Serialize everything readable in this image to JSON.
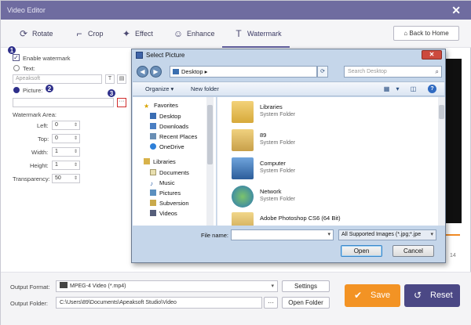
{
  "app": {
    "title": "Video Editor",
    "close_glyph": "✕"
  },
  "toolbar": {
    "tabs": [
      {
        "label": "Rotate",
        "icon": "rotate-icon",
        "glyph": "⟳"
      },
      {
        "label": "Crop",
        "icon": "crop-icon",
        "glyph": "⌐"
      },
      {
        "label": "Effect",
        "icon": "effect-icon",
        "glyph": "✦"
      },
      {
        "label": "Enhance",
        "icon": "enhance-icon",
        "glyph": "☺"
      },
      {
        "label": "Watermark",
        "icon": "watermark-icon",
        "glyph": "T"
      }
    ],
    "active_tab": "Watermark",
    "back_home": "Back to Home"
  },
  "steps": {
    "one": "1",
    "two": "2",
    "three": "3"
  },
  "watermark": {
    "enable_label": "Enable watermark",
    "enable_checked": true,
    "text_label": "Text:",
    "text_value": "Apeaksoft",
    "picture_label": "Picture:",
    "picture_value": "",
    "mode": "Picture",
    "browse_label": "···",
    "area_label": "Watermark Area:",
    "left_label": "Left:",
    "left_value": "0",
    "top_label": "Top:",
    "top_value": "0",
    "width_label": "Width:",
    "width_value": "1",
    "height_label": "Height:",
    "height_value": "1",
    "transparency_label": "Transparency:",
    "transparency_value": "50"
  },
  "preview": {
    "time_text": "14"
  },
  "output": {
    "format_label": "Output Format:",
    "format_value": "MPEG-4 Video (*.mp4)",
    "settings_label": "Settings",
    "folder_label": "Output Folder:",
    "folder_value": "C:\\Users\\89\\Documents\\Apeaksoft Studio\\Video",
    "folder_browse": "···",
    "open_folder_label": "Open Folder"
  },
  "actions": {
    "save_label": "Save",
    "reset_label": "Reset",
    "save_color": "#f39324",
    "reset_color": "#4b4885"
  },
  "dialog": {
    "title": "Select Picture",
    "close_glyph": "✕",
    "address": "Desktop",
    "search_placeholder": "Search Desktop",
    "organize_label": "Organize ▾",
    "new_folder_label": "New folder",
    "nav": [
      {
        "label": "Favorites",
        "icon": "star-icon"
      },
      {
        "label": "Desktop",
        "icon": "desktop-icon"
      },
      {
        "label": "Downloads",
        "icon": "downloads-icon"
      },
      {
        "label": "Recent Places",
        "icon": "recent-places-icon"
      },
      {
        "label": "OneDrive",
        "icon": "onedrive-icon"
      },
      {
        "label": "Libraries",
        "icon": "libraries-icon"
      },
      {
        "label": "Documents",
        "icon": "documents-icon"
      },
      {
        "label": "Music",
        "icon": "music-icon"
      },
      {
        "label": "Pictures",
        "icon": "pictures-icon"
      },
      {
        "label": "Subversion",
        "icon": "subversion-icon"
      },
      {
        "label": "Videos",
        "icon": "videos-icon"
      }
    ],
    "files": [
      {
        "name": "Libraries",
        "type": "System Folder",
        "icon": "folder-libraries-icon"
      },
      {
        "name": "89",
        "type": "System Folder",
        "icon": "user-folder-icon"
      },
      {
        "name": "Computer",
        "type": "System Folder",
        "icon": "computer-icon"
      },
      {
        "name": "Network",
        "type": "System Folder",
        "icon": "network-icon"
      },
      {
        "name": "Adobe Photoshop CS6 (64 Bit)",
        "type": "",
        "icon": "photoshop-shortcut-icon"
      }
    ],
    "filename_label": "File name:",
    "filename_value": "",
    "filetype_value": "All Supported Images (*.jpg;*.jpe",
    "open_label": "Open",
    "cancel_label": "Cancel"
  }
}
